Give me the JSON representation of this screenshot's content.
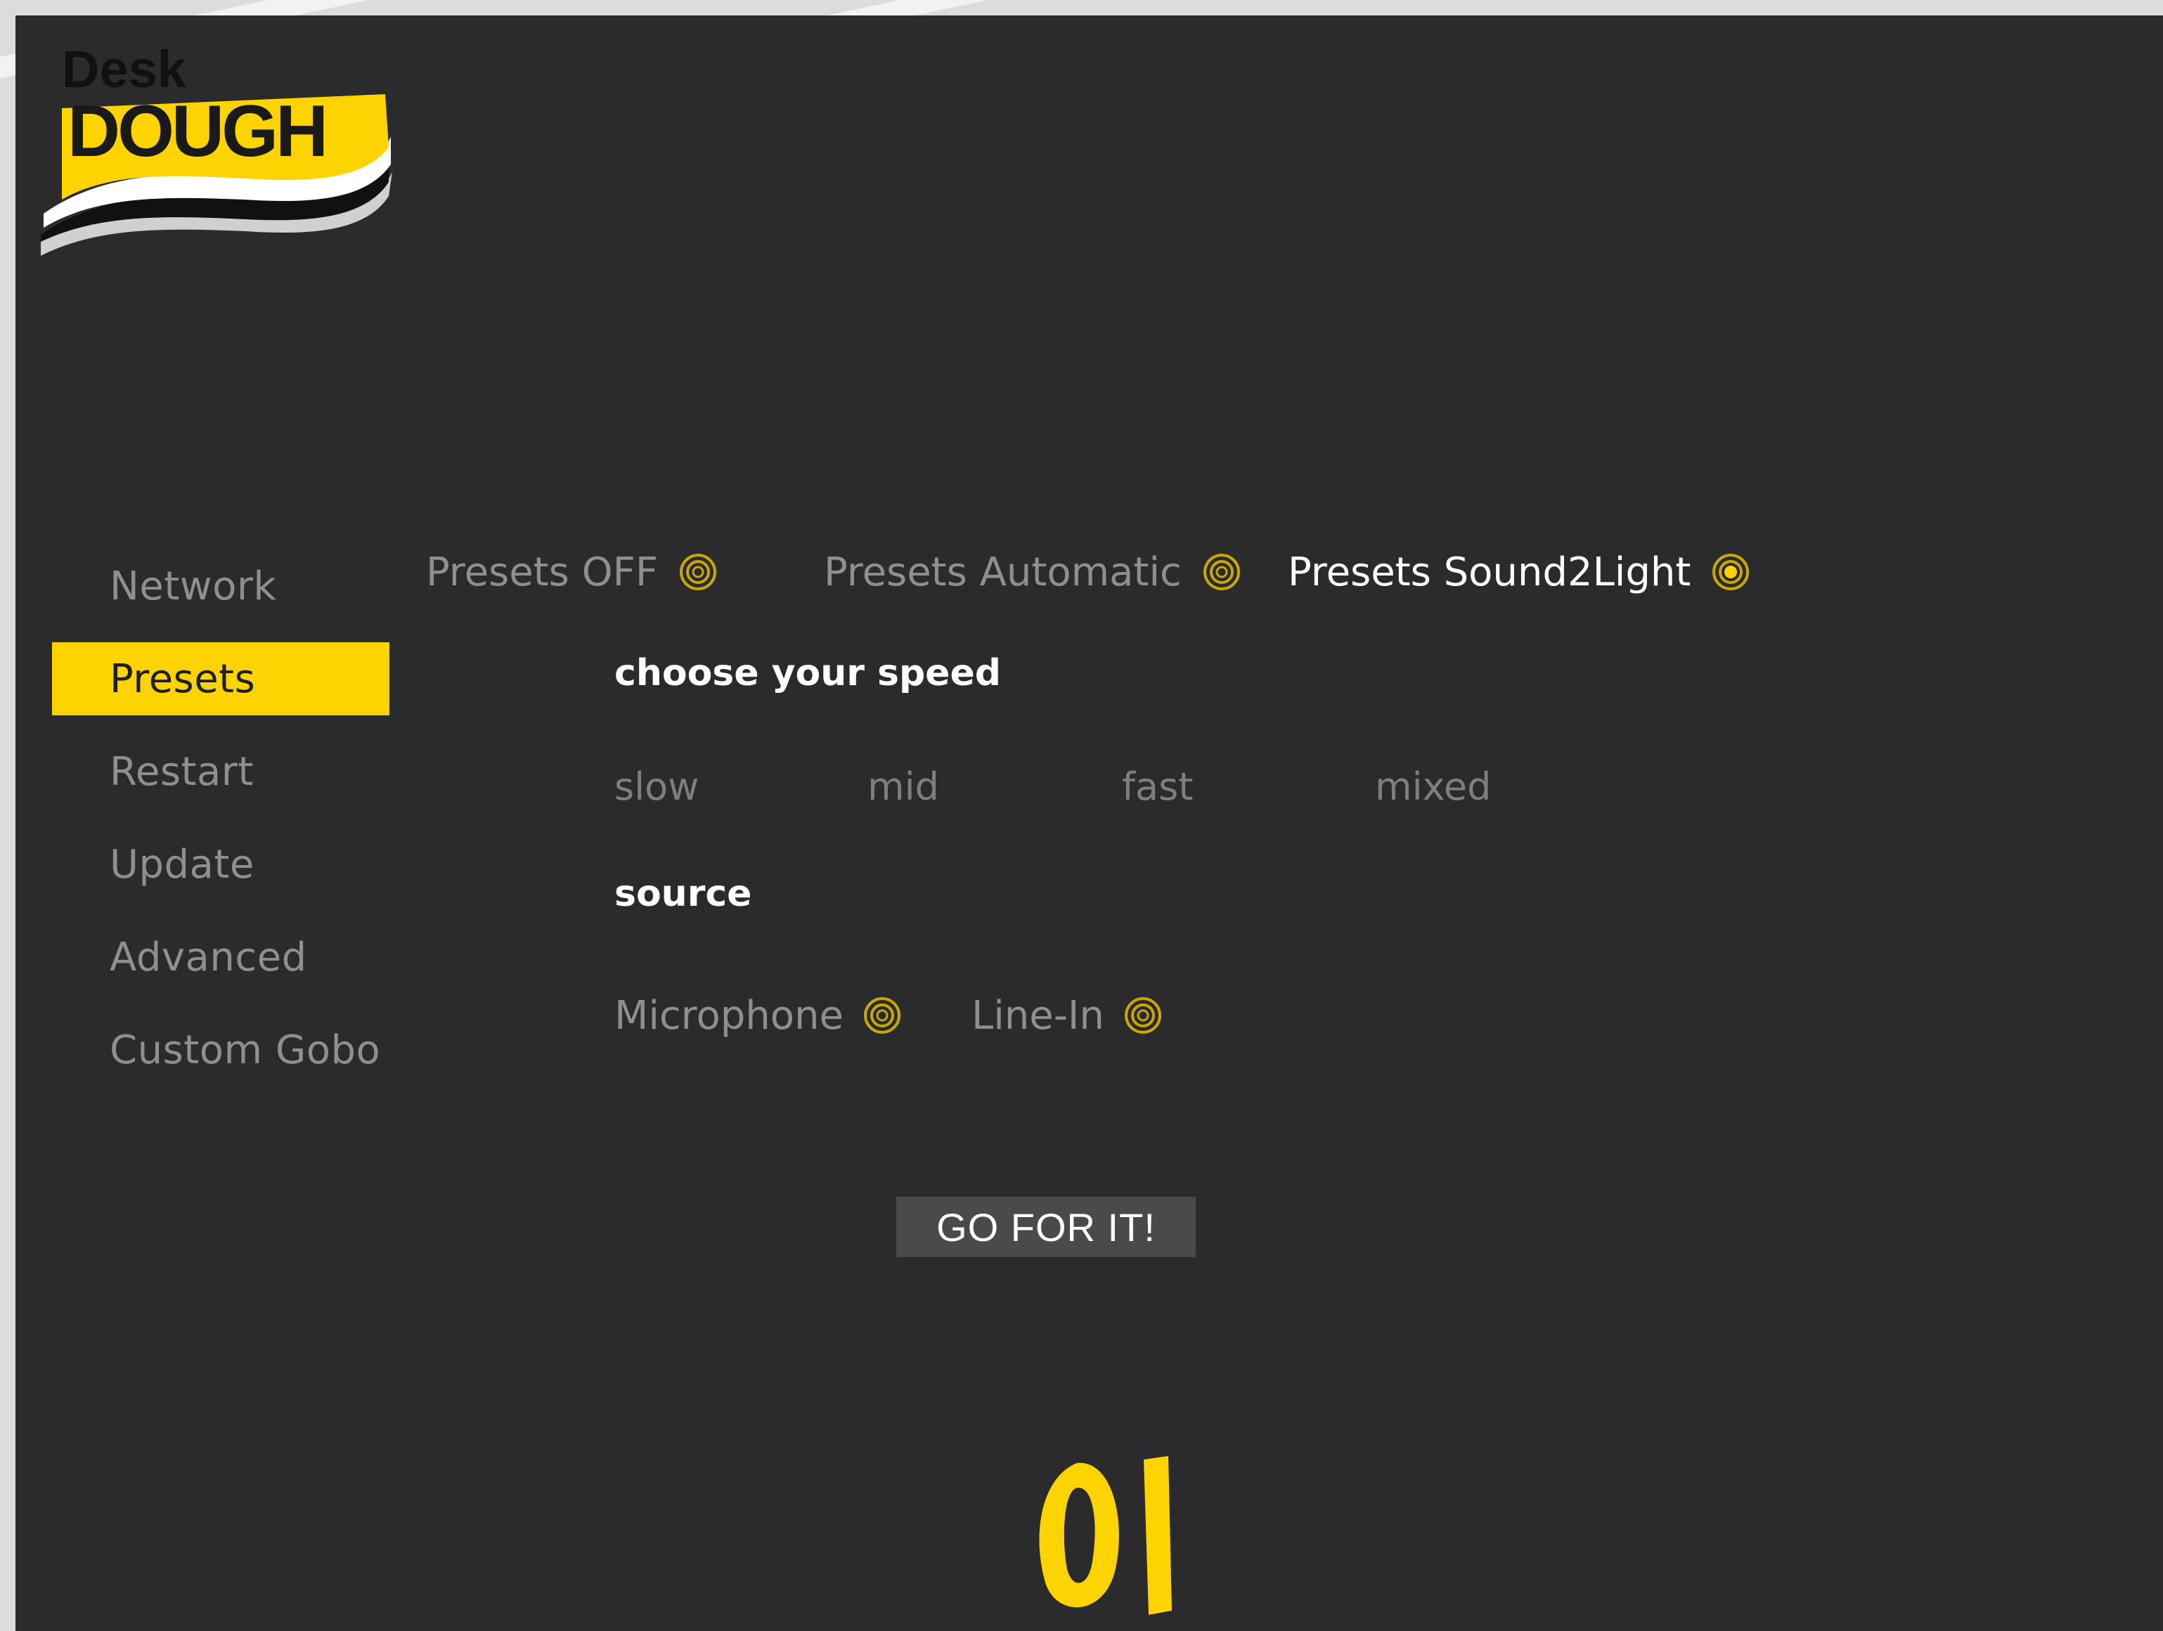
{
  "logo": {
    "top_text": "Desk",
    "main_text": "DOUGH"
  },
  "sidebar": {
    "items": [
      {
        "label": "Network",
        "active": false
      },
      {
        "label": "Presets",
        "active": true
      },
      {
        "label": "Restart",
        "active": false
      },
      {
        "label": "Update",
        "active": false
      },
      {
        "label": "Advanced",
        "active": false
      },
      {
        "label": "Custom Gobo",
        "active": false
      }
    ]
  },
  "modes": [
    {
      "label": "Presets OFF",
      "selected": false
    },
    {
      "label": "Presets Automatic",
      "selected": false
    },
    {
      "label": "Presets Sound2Light",
      "selected": true
    }
  ],
  "speed": {
    "title": "choose your speed",
    "options": [
      "slow",
      "mid",
      "fast",
      "mixed"
    ]
  },
  "source": {
    "title": "source",
    "options": [
      {
        "label": "Microphone",
        "selected": false
      },
      {
        "label": "Line-In",
        "selected": false
      }
    ]
  },
  "action_button": {
    "label": "GO FOR IT!"
  },
  "colors": {
    "accent": "#fed400",
    "panel": "#2b2a2d",
    "muted_text": "#8f8f92",
    "button": "#4a494c"
  },
  "icons": {
    "radio": "radio-target-icon",
    "brand": "brand-mark-icon"
  }
}
